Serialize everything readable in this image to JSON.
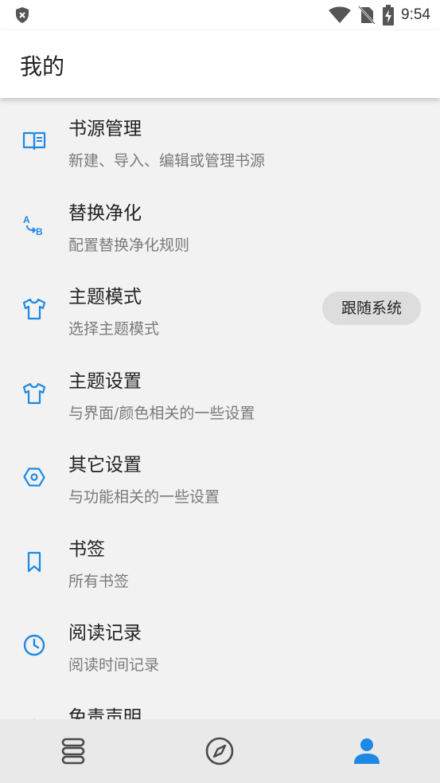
{
  "status_bar": {
    "time": "9:54"
  },
  "app_bar": {
    "title": "我的"
  },
  "items": [
    {
      "title": "书源管理",
      "subtitle": "新建、导入、编辑或管理书源",
      "icon": "book-open-icon"
    },
    {
      "title": "替换净化",
      "subtitle": "配置替换净化规则",
      "icon": "replace-ab-icon"
    },
    {
      "title": "主题模式",
      "subtitle": "选择主题模式",
      "icon": "shirt-icon",
      "value": "跟随系统"
    },
    {
      "title": "主题设置",
      "subtitle": "与界面/颜色相关的一些设置",
      "icon": "shirt-icon"
    },
    {
      "title": "其它设置",
      "subtitle": "与功能相关的一些设置",
      "icon": "hexagon-nut-icon"
    },
    {
      "title": "书签",
      "subtitle": "所有书签",
      "icon": "bookmark-icon"
    },
    {
      "title": "阅读记录",
      "subtitle": "阅读时间记录",
      "icon": "clock-icon"
    },
    {
      "title": "免责声明",
      "subtitle": "",
      "icon": "disclaimer-icon"
    }
  ],
  "bottom_nav": [
    {
      "name": "bookshelf-icon",
      "active": false
    },
    {
      "name": "compass-icon",
      "active": false
    },
    {
      "name": "person-icon",
      "active": true
    }
  ],
  "colors": {
    "accent": "#1e88e5",
    "icon_inactive": "#4a4a4a"
  }
}
